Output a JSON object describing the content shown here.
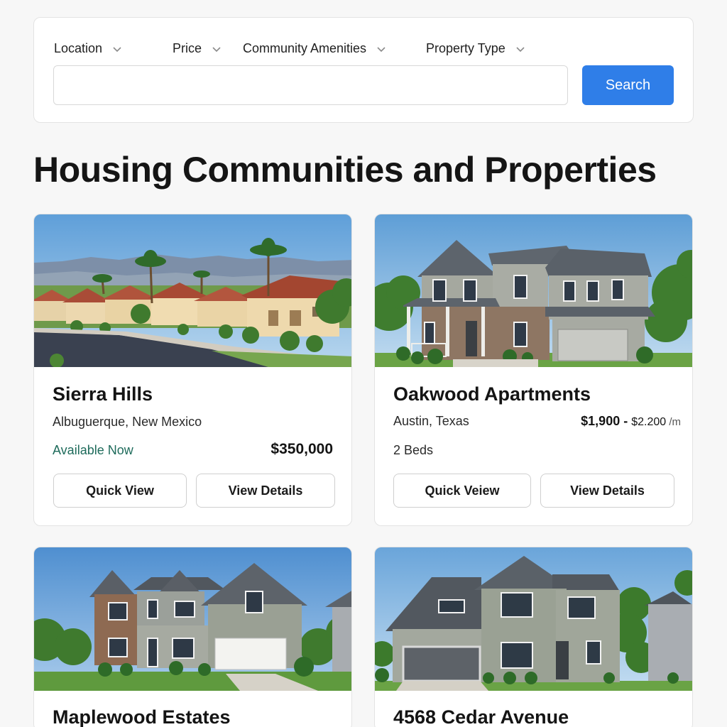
{
  "filters": [
    {
      "label": "Location",
      "icon": "chevron-down-icon"
    },
    {
      "label": "Price",
      "icon": "chevron-down-icon"
    },
    {
      "label": "Community Amenities",
      "icon": "chevron-down-icon"
    },
    {
      "label": "Property Type",
      "icon": "chevron-down-icon"
    }
  ],
  "search": {
    "placeholder": "",
    "value": "",
    "button_label": "Search"
  },
  "page_title": "Housing Communities and Properties",
  "accent_color": "#2f7ee8",
  "available_color": "#1e6b5b",
  "cards": [
    {
      "name": "Sierra Hills",
      "location": "Albuguerque, New Mexico",
      "availability": "Available Now",
      "price": "$350,000",
      "quick_view_label": "Quick View",
      "details_label": "View Details"
    },
    {
      "name": "Oakwood Apartments",
      "location": "Austin, Texas",
      "price_low": "$1,900",
      "price_sep": " - ",
      "price_high": "$2.200",
      "price_unit": " /m",
      "beds": "2 Beds",
      "quick_view_label": "Quick Veiew",
      "details_label": "View Details"
    },
    {
      "name": "Maplewood Estates"
    },
    {
      "name": "4568 Cedar Avenue"
    }
  ]
}
